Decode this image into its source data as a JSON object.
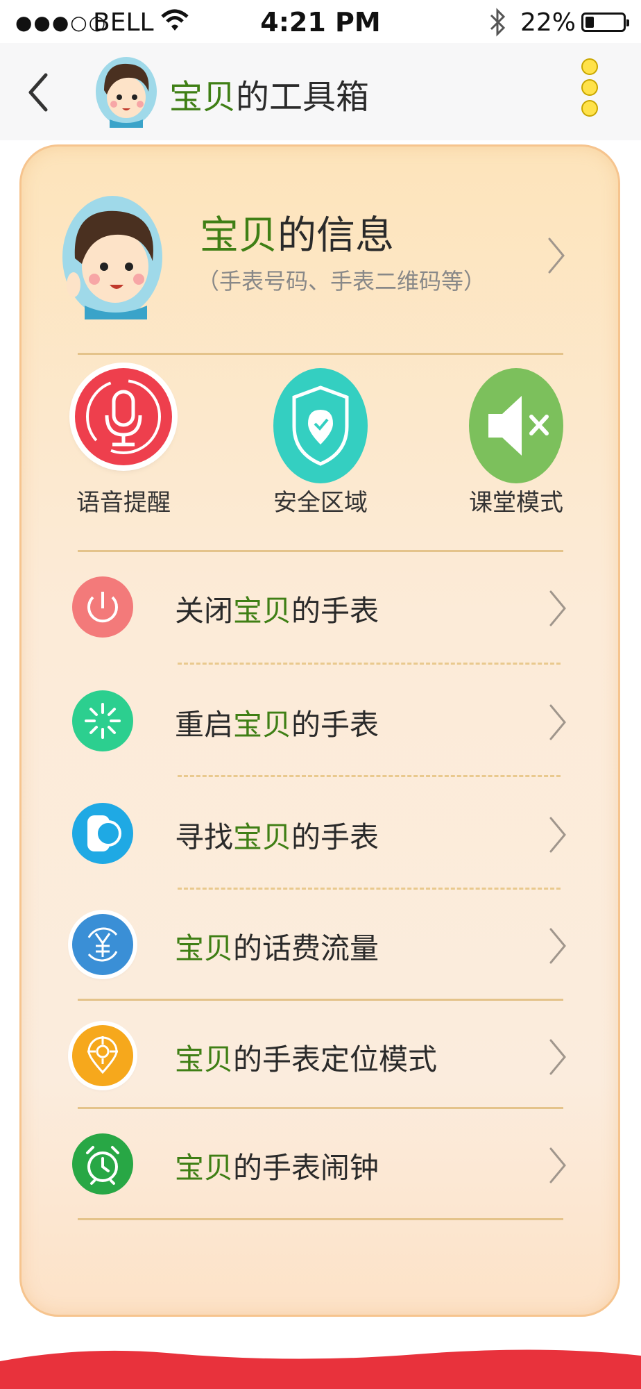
{
  "status_bar": {
    "signal": "●●●○○",
    "carrier": "BELL",
    "time": "4:21 PM",
    "battery": "22%",
    "battery_level": 0.22
  },
  "nav": {
    "title_highlight": "宝贝",
    "title_rest": "的工具箱"
  },
  "info": {
    "title_highlight": "宝贝",
    "title_rest": "的信息",
    "subtitle": "（手表号码、手表二维码等）"
  },
  "features": [
    {
      "label": "语音提醒",
      "icon": "microphone-icon",
      "color": "#ee3f4d"
    },
    {
      "label": "安全区域",
      "icon": "shield-icon",
      "color": "#34cfc1"
    },
    {
      "label": "课堂模式",
      "icon": "mute-speaker-icon",
      "color": "#7cc05c"
    }
  ],
  "rows": [
    {
      "pre": "关闭",
      "hl": "宝贝",
      "post": "的手表",
      "icon": "power-icon",
      "color": "#f37a7a"
    },
    {
      "pre": "重启",
      "hl": "宝贝",
      "post": "的手表",
      "icon": "restart-icon",
      "color": "#2ccf8f"
    },
    {
      "pre": "寻找",
      "hl": "宝贝",
      "post": "的手表",
      "icon": "watch-icon",
      "color": "#1fa9e4"
    },
    {
      "pre": "",
      "hl": "宝贝",
      "post": "的话费流量",
      "icon": "yuan-icon",
      "color": "#3a8fd6"
    },
    {
      "pre": "",
      "hl": "宝贝",
      "post": "的手表定位模式",
      "icon": "location-target-icon",
      "color": "#f6a81c"
    },
    {
      "pre": "",
      "hl": "宝贝",
      "post": "的手表闹钟",
      "icon": "alarm-clock-icon",
      "color": "#28a745"
    }
  ],
  "colors": {
    "highlight": "#3f7f15",
    "card_border": "#f6c48e",
    "more_dots": "#ffe24a",
    "bottom_wave": "#e8323c"
  }
}
